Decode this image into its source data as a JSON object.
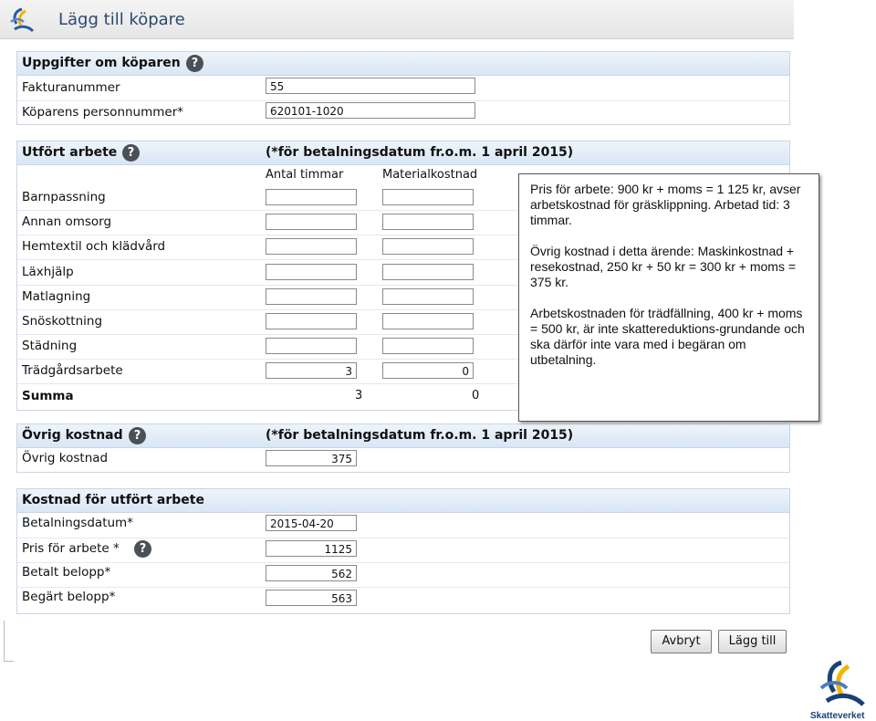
{
  "header": {
    "title": "Lägg till köpare",
    "logo_icon": "skatteverket-swirl-icon"
  },
  "buyer": {
    "heading": "Uppgifter om köparen",
    "fields": [
      {
        "label": "Fakturanummer",
        "value": "55"
      },
      {
        "label": "Köparens personnummer*",
        "value": "620101-1020"
      }
    ]
  },
  "work": {
    "heading": "Utfört arbete",
    "note": "(*för betalningsdatum fr.o.m. 1 april 2015)",
    "col_hours": "Antal timmar",
    "col_material": "Materialkostnad",
    "rows": [
      {
        "label": "Barnpassning",
        "hours": "",
        "material": ""
      },
      {
        "label": "Annan omsorg",
        "hours": "",
        "material": ""
      },
      {
        "label": "Hemtextil och klädvård",
        "hours": "",
        "material": ""
      },
      {
        "label": "Läxhjälp",
        "hours": "",
        "material": ""
      },
      {
        "label": "Matlagning",
        "hours": "",
        "material": ""
      },
      {
        "label": "Snöskottning",
        "hours": "",
        "material": ""
      },
      {
        "label": "Städning",
        "hours": "",
        "material": ""
      },
      {
        "label": "Trädgårdsarbete",
        "hours": "3",
        "material": "0"
      }
    ],
    "sum_label": "Summa",
    "sum_hours": "3",
    "sum_material": "0"
  },
  "other": {
    "heading": "Övrig kostnad",
    "note": "(*för betalningsdatum fr.o.m. 1 april 2015)",
    "label": "Övrig kostnad",
    "value": "375"
  },
  "cost": {
    "heading": "Kostnad för utfört arbete",
    "fields": [
      {
        "label": "Betalningsdatum*",
        "value": "2015-04-20"
      },
      {
        "label": "Pris för arbete *",
        "value": "1125"
      },
      {
        "label": "Betalt belopp*",
        "value": "562"
      },
      {
        "label": "Begärt belopp*",
        "value": "563"
      }
    ]
  },
  "help_symbol": "?",
  "tooltip": {
    "p1": "Pris för arbete: 900 kr + moms = 1 125 kr, avser arbetskostnad för gräsklippning. Arbetad tid: 3 timmar.",
    "p2": "Övrig kostnad i detta ärende: Maskinkostnad + resekostnad, 250 kr + 50 kr = 300 kr + moms = 375 kr.",
    "p3": "Arbetskostnaden för trädfällning, 400 kr + moms = 500 kr, är inte skattereduktions-grundande och ska därför inte vara med i begäran om utbetalning."
  },
  "buttons": {
    "cancel": "Avbryt",
    "add": "Lägg till"
  },
  "brand": {
    "name": "Skatteverket",
    "icon": "skatteverket-logo-icon"
  },
  "colors": {
    "section_header": "#dbe7f4",
    "title": "#2a4a6e",
    "brand": "#1c3f78",
    "brand_accent": "#f2b400"
  }
}
